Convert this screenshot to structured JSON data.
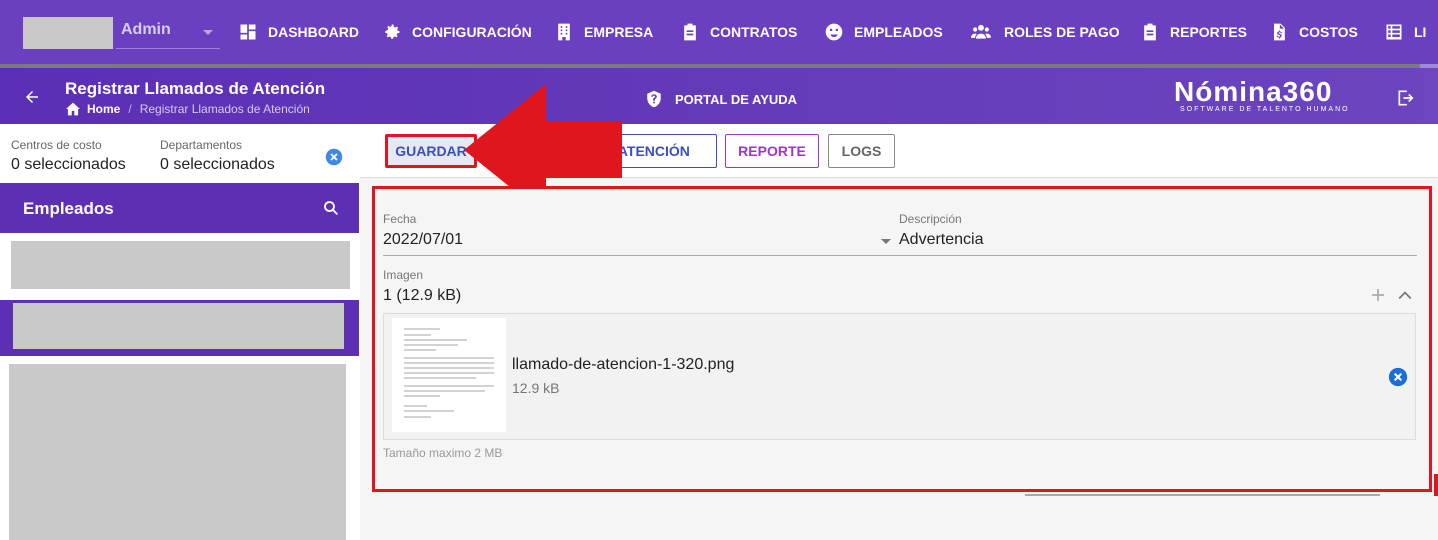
{
  "header": {
    "user": "Admin",
    "nav": [
      {
        "label": "DASHBOARD",
        "icon": "dashboard-icon"
      },
      {
        "label": "CONFIGURACIÓN",
        "icon": "gear-icon"
      },
      {
        "label": "EMPRESA",
        "icon": "building-icon"
      },
      {
        "label": "CONTRATOS",
        "icon": "clipboard-icon"
      },
      {
        "label": "EMPLEADOS",
        "icon": "face-icon"
      },
      {
        "label": "ROLES DE PAGO",
        "icon": "people-icon"
      },
      {
        "label": "REPORTES",
        "icon": "clipboard-icon"
      },
      {
        "label": "COSTOS",
        "icon": "dollar-file-icon"
      },
      {
        "label": "LI",
        "icon": "list-icon"
      }
    ]
  },
  "subbar": {
    "title": "Registrar Llamados de Atención",
    "breadcrumb_home": "Home",
    "breadcrumb_current": "Registrar Llamados de Atención",
    "help": "PORTAL DE AYUDA",
    "logo_name": "Nómina360",
    "logo_tag": "SOFTWARE DE TALENTO HUMANO"
  },
  "filters": {
    "cost_centers_label": "Centros de costo",
    "cost_centers_value": "0 seleccionados",
    "departments_label": "Departamentos",
    "departments_value": "0 seleccionados"
  },
  "employees": {
    "title": "Empleados"
  },
  "toolbar": {
    "save": "GUARDAR",
    "llamado": "E ATENCIÓN",
    "report": "REPORTE",
    "logs": "LOGS"
  },
  "form": {
    "date_label": "Fecha",
    "date_value": "2022/07/01",
    "desc_label": "Descripción",
    "desc_value": "Advertencia",
    "image_label": "Imagen",
    "image_value": "1 (12.9 kB)",
    "file_name": "llamado-de-atencion-1-320.png",
    "file_size": "12.9 kB",
    "hint": "Tamaño maximo 2 MB"
  },
  "colors": {
    "primary": "#6a3fc0",
    "accent": "#e0161f",
    "blue": "#3b4fb8"
  }
}
